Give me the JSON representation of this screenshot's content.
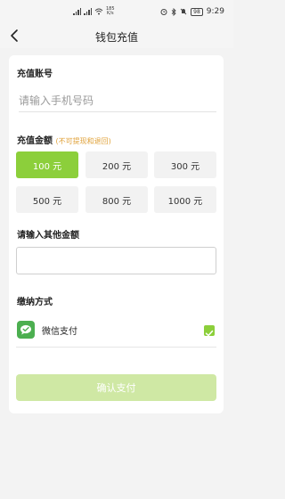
{
  "status_bar": {
    "net_speed_value": "185",
    "net_speed_unit": "K/s",
    "battery": "98",
    "time": "9:29",
    "icons": [
      "sim-signal-icon",
      "wifi-icon",
      "alarm-icon",
      "bluetooth-icon",
      "mute-icon",
      "battery-icon"
    ]
  },
  "nav": {
    "title": "钱包充值",
    "back_icon": "chevron-left-icon"
  },
  "account": {
    "title": "充值账号",
    "placeholder": "请输入手机号码"
  },
  "amount": {
    "title": "充值金额",
    "note": "(不可提现和退回)",
    "options": [
      "100 元",
      "200 元",
      "300 元",
      "500 元",
      "800 元",
      "1000 元"
    ],
    "selected_index": 0
  },
  "other_amount": {
    "title": "请输入其他金额",
    "value": ""
  },
  "payment": {
    "title": "缴纳方式",
    "method_label": "微信支付",
    "icon": "wechat-pay-icon",
    "checked": true
  },
  "confirm": {
    "label": "确认支付"
  },
  "colors": {
    "accent": "#8ccf3b",
    "accent_disabled": "#cfe8a4",
    "note": "#e0a23a",
    "wechat": "#4caf50"
  }
}
